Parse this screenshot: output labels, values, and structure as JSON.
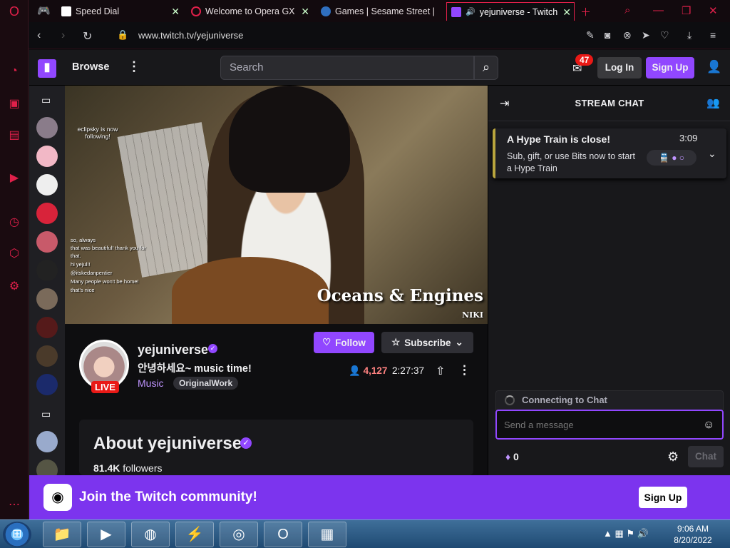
{
  "browser": {
    "tabs": [
      {
        "title": "Speed Dial"
      },
      {
        "title": "Welcome to Opera GX"
      },
      {
        "title": "Games | Sesame Street |"
      },
      {
        "title": "yejuniverse - Twitch"
      }
    ],
    "url": "www.twitch.tv/yejuniverse"
  },
  "twitch_header": {
    "logo": "twitch-logo",
    "browse": "Browse",
    "search_placeholder": "Search",
    "notification_count": "47",
    "login": "Log In",
    "signup": "Sign Up"
  },
  "video": {
    "caption": "Oceans & Engines",
    "caption_artist": "NIKI",
    "follow_alert": "eclipsky is now following!",
    "overlay_chat": [
      "so, always",
      "that was beautiful! thank you for",
      "that.",
      "hi yejul!!",
      "@itskedanpentier",
      "Many people won't be home!",
      "that's nice"
    ]
  },
  "channel": {
    "name": "yejuniverse",
    "live_label": "LIVE",
    "title": "안녕하세요~ music time!",
    "category": "Music",
    "tag": "OriginalWork",
    "follow": "Follow",
    "subscribe": "Subscribe",
    "viewers": "4,127",
    "uptime": "2:27:37"
  },
  "about": {
    "title": "About yejuniverse",
    "followers_count": "81.4K",
    "followers_label": "followers"
  },
  "chat": {
    "title": "STREAM CHAT",
    "hype_title": "A Hype Train is close!",
    "hype_time": "3:09",
    "hype_desc": "Sub, gift, or use Bits now to start a Hype Train",
    "connecting": "Connecting to Chat",
    "input_placeholder": "Send a message",
    "bits": "0",
    "send": "Chat"
  },
  "banner": {
    "text": "Join the Twitch community!",
    "signup": "Sign Up"
  },
  "taskbar": {
    "time": "9:06 AM",
    "date": "8/20/2022"
  },
  "colors": {
    "twitch_purple": "#9147ff",
    "opera_red": "#e0204a",
    "live_red": "#e91916"
  }
}
